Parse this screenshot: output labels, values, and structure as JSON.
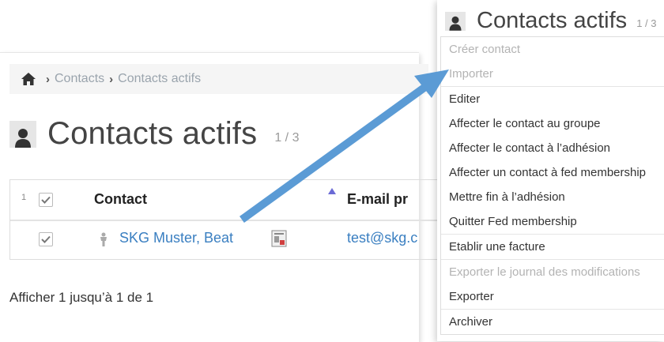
{
  "breadcrumb": {
    "items": [
      "Contacts",
      "Contacts actifs"
    ]
  },
  "page": {
    "title": "Contacts actifs",
    "count": "1 / 3"
  },
  "table": {
    "row_count_label": "1",
    "headers": {
      "contact": "Contact",
      "email": "E-mail pr"
    },
    "rows": [
      {
        "contact": "SKG Muster, Beat",
        "email": "test@skg.c"
      }
    ]
  },
  "pager": "Afficher 1 jusqu’à 1 de 1",
  "menu": {
    "title": "Contacts actifs",
    "count": "1 / 3",
    "items": [
      {
        "label": "Créer contact",
        "disabled": true
      },
      {
        "label": "Importer",
        "disabled": true
      },
      {
        "label": "Editer",
        "disabled": false
      },
      {
        "label": "Affecter le contact au groupe",
        "disabled": false
      },
      {
        "label": "Affecter le contact à l’adhésion",
        "disabled": false
      },
      {
        "label": "Affecter un contact à fed membership",
        "disabled": false
      },
      {
        "label": "Mettre fin à l’adhésion",
        "disabled": false
      },
      {
        "label": "Quitter Fed membership",
        "disabled": false
      },
      {
        "label": "Etablir une facture",
        "disabled": false
      },
      {
        "label": "Exporter le journal des modifications",
        "disabled": true
      },
      {
        "label": "Exporter",
        "disabled": false
      },
      {
        "label": "Archiver",
        "disabled": false
      }
    ]
  },
  "colors": {
    "link": "#3a7fc1",
    "arrow": "#5b9bd5",
    "disabled": "#b3b3b3"
  }
}
